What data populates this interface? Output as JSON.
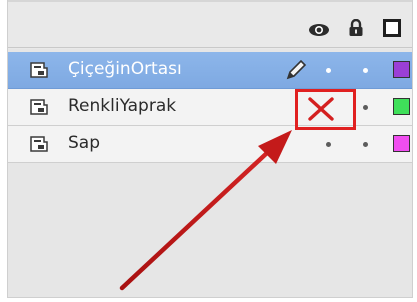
{
  "layers_panel": {
    "header_icons": [
      "eye-icon",
      "lock-icon",
      "outline-icon"
    ],
    "layers": [
      {
        "name": "ÇiçeğinOrtası",
        "selected": true,
        "state_icon": "pencil-icon",
        "color": "#9b3fd6"
      },
      {
        "name": "RenkliYaprak",
        "selected": false,
        "state_icon": "hidden-x-icon",
        "color": "#3fe05a"
      },
      {
        "name": "Sap",
        "selected": false,
        "state_icon": "none",
        "color": "#f04ef0"
      }
    ]
  },
  "annotation": {
    "highlight_color": "#e02020",
    "arrow_color": "#c41a1a"
  }
}
